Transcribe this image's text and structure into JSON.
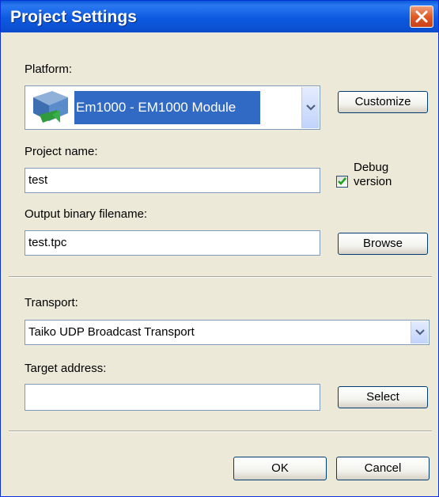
{
  "dialog": {
    "title": "Project Settings"
  },
  "platform": {
    "label": "Platform:",
    "selected": "Em1000 - EM1000 Module",
    "customize_label": "Customize"
  },
  "project": {
    "name_label": "Project name:",
    "name_value": "test",
    "debug_label_line1": "Debug",
    "debug_label_line2": "version",
    "debug_checked": true
  },
  "output": {
    "label": "Output binary filename:",
    "value": "test.tpc",
    "browse_label": "Browse"
  },
  "transport": {
    "label": "Transport:",
    "selected": "Taiko UDP Broadcast Transport"
  },
  "target": {
    "label": "Target address:",
    "value": "",
    "select_label": "Select"
  },
  "footer": {
    "ok_label": "OK",
    "cancel_label": "Cancel"
  },
  "colors": {
    "titlebar": "#0a5bd6",
    "selection": "#316ac5",
    "dialog_bg": "#ece9d8"
  }
}
